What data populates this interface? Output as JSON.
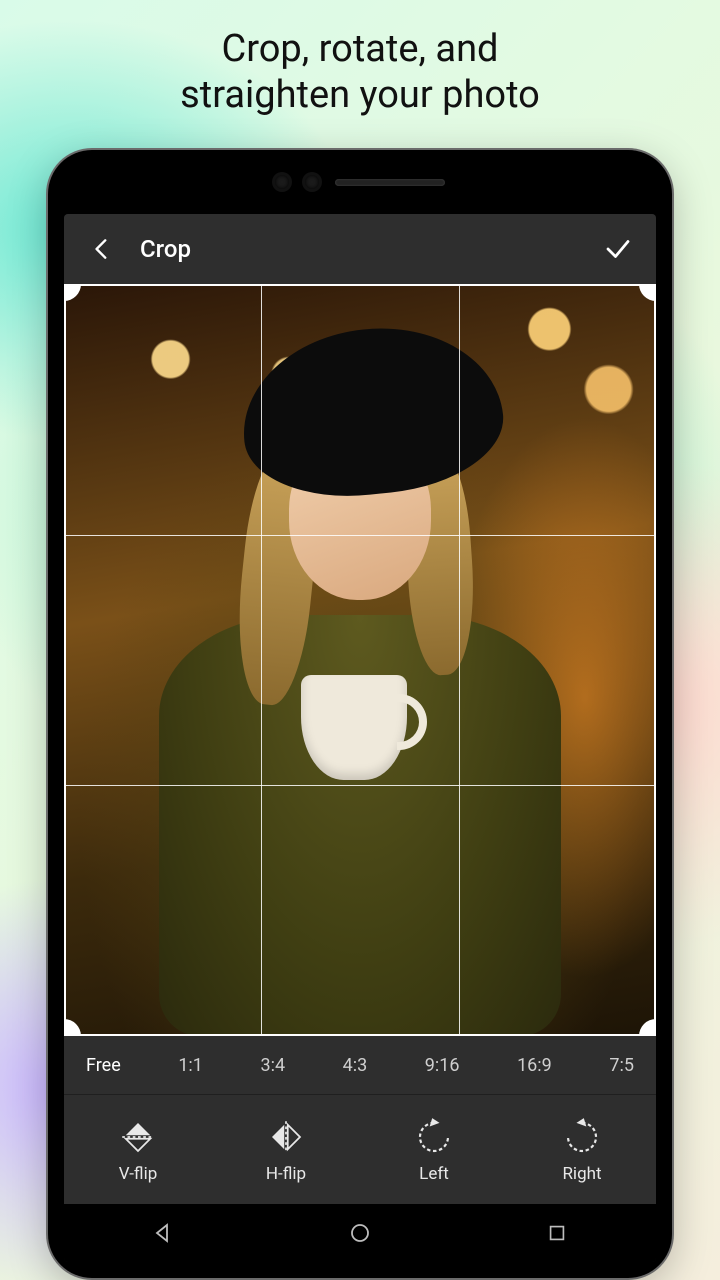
{
  "promo": {
    "headline_line1": "Crop, rotate, and",
    "headline_line2": "straighten your photo"
  },
  "header": {
    "title": "Crop",
    "back_icon": "chevron-left",
    "confirm_icon": "checkmark"
  },
  "ratios": [
    {
      "label": "Free",
      "active": true
    },
    {
      "label": "1:1",
      "active": false
    },
    {
      "label": "3:4",
      "active": false
    },
    {
      "label": "4:3",
      "active": false
    },
    {
      "label": "9:16",
      "active": false
    },
    {
      "label": "16:9",
      "active": false
    },
    {
      "label": "7:5",
      "active": false
    }
  ],
  "tools": [
    {
      "id": "vflip",
      "label": "V-flip",
      "icon": "flip-vertical"
    },
    {
      "id": "hflip",
      "label": "H-flip",
      "icon": "flip-horizontal"
    },
    {
      "id": "left",
      "label": "Left",
      "icon": "rotate-left"
    },
    {
      "id": "right",
      "label": "Right",
      "icon": "rotate-right"
    }
  ],
  "nav": {
    "back": "triangle-left",
    "home": "circle",
    "recent": "square"
  },
  "colors": {
    "surface": "#2e2e2e",
    "text": "#ffffff",
    "muted": "#cfcfcf"
  }
}
